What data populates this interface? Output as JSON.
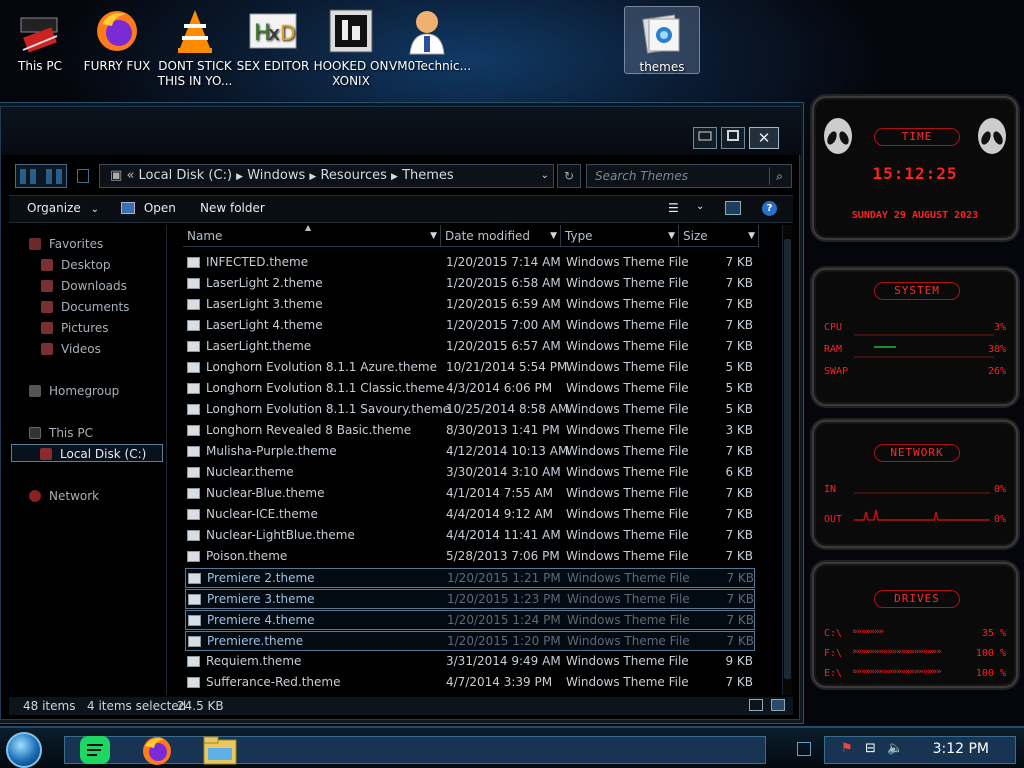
{
  "desktop_icons": [
    {
      "label": "This PC",
      "icon": "computer-icon"
    },
    {
      "label": "FURRY FUX",
      "icon": "firefox-icon"
    },
    {
      "label": "DONT STICK THIS IN YO...",
      "icon": "vlc-icon"
    },
    {
      "label": "SEX EDITOR",
      "icon": "hex-editor-icon"
    },
    {
      "label": "HOOKED ON XONIX",
      "icon": "game-icon"
    },
    {
      "label": "VM0Technic...",
      "icon": "doctor-icon"
    },
    {
      "label": "themes",
      "icon": "folder-icon"
    }
  ],
  "window": {
    "breadcrumb": [
      "Local Disk (C:)",
      "Windows",
      "Resources",
      "Themes"
    ],
    "search_placeholder": "Search Themes",
    "toolbar": {
      "organize": "Organize",
      "open": "Open",
      "new_folder": "New folder"
    },
    "nav": {
      "favorites": "Favorites",
      "desktop": "Desktop",
      "downloads": "Downloads",
      "documents": "Documents",
      "pictures": "Pictures",
      "videos": "Videos",
      "homegroup": "Homegroup",
      "this_pc": "This PC",
      "local_disk": "Local Disk (C:)",
      "network": "Network"
    },
    "columns": {
      "name": "Name",
      "date": "Date modified",
      "type": "Type",
      "size": "Size"
    },
    "files": [
      {
        "name": "INFECTED.theme",
        "date": "1/20/2015 7:14 AM",
        "type": "Windows Theme File",
        "size": "7 KB",
        "sel": false
      },
      {
        "name": "LaserLight 2.theme",
        "date": "1/20/2015 6:58 AM",
        "type": "Windows Theme File",
        "size": "7 KB",
        "sel": false
      },
      {
        "name": "LaserLight 3.theme",
        "date": "1/20/2015 6:59 AM",
        "type": "Windows Theme File",
        "size": "7 KB",
        "sel": false
      },
      {
        "name": "LaserLight 4.theme",
        "date": "1/20/2015 7:00 AM",
        "type": "Windows Theme File",
        "size": "7 KB",
        "sel": false
      },
      {
        "name": "LaserLight.theme",
        "date": "1/20/2015 6:57 AM",
        "type": "Windows Theme File",
        "size": "7 KB",
        "sel": false
      },
      {
        "name": "Longhorn Evolution 8.1.1 Azure.theme",
        "date": "10/21/2014 5:54 PM",
        "type": "Windows Theme File",
        "size": "5 KB",
        "sel": false
      },
      {
        "name": "Longhorn Evolution 8.1.1 Classic.theme",
        "date": "4/3/2014 6:06 PM",
        "type": "Windows Theme File",
        "size": "5 KB",
        "sel": false
      },
      {
        "name": "Longhorn Evolution 8.1.1 Savoury.theme",
        "date": "10/25/2014 8:58 AM",
        "type": "Windows Theme File",
        "size": "5 KB",
        "sel": false
      },
      {
        "name": "Longhorn Revealed 8 Basic.theme",
        "date": "8/30/2013 1:41 PM",
        "type": "Windows Theme File",
        "size": "3 KB",
        "sel": false
      },
      {
        "name": "Mulisha-Purple.theme",
        "date": "4/12/2014 10:13 AM",
        "type": "Windows Theme File",
        "size": "7 KB",
        "sel": false
      },
      {
        "name": "Nuclear.theme",
        "date": "3/30/2014 3:10 AM",
        "type": "Windows Theme File",
        "size": "6 KB",
        "sel": false
      },
      {
        "name": "Nuclear-Blue.theme",
        "date": "4/1/2014 7:55 AM",
        "type": "Windows Theme File",
        "size": "7 KB",
        "sel": false
      },
      {
        "name": "Nuclear-ICE.theme",
        "date": "4/4/2014 9:12 AM",
        "type": "Windows Theme File",
        "size": "7 KB",
        "sel": false
      },
      {
        "name": "Nuclear-LightBlue.theme",
        "date": "4/4/2014 11:41 AM",
        "type": "Windows Theme File",
        "size": "7 KB",
        "sel": false
      },
      {
        "name": "Poison.theme",
        "date": "5/28/2013 7:06 PM",
        "type": "Windows Theme File",
        "size": "7 KB",
        "sel": false
      },
      {
        "name": "Premiere 2.theme",
        "date": "1/20/2015 1:21 PM",
        "type": "Windows Theme File",
        "size": "7 KB",
        "sel": true
      },
      {
        "name": "Premiere 3.theme",
        "date": "1/20/2015 1:23 PM",
        "type": "Windows Theme File",
        "size": "7 KB",
        "sel": true
      },
      {
        "name": "Premiere 4.theme",
        "date": "1/20/2015 1:24 PM",
        "type": "Windows Theme File",
        "size": "7 KB",
        "sel": true
      },
      {
        "name": "Premiere.theme",
        "date": "1/20/2015 1:20 PM",
        "type": "Windows Theme File",
        "size": "7 KB",
        "sel": true
      },
      {
        "name": "Requiem.theme",
        "date": "3/31/2014 9:49 AM",
        "type": "Windows Theme File",
        "size": "9 KB",
        "sel": false
      },
      {
        "name": "Sufferance-Red.theme",
        "date": "4/7/2014 3:39 PM",
        "type": "Windows Theme File",
        "size": "7 KB",
        "sel": false
      }
    ],
    "status": {
      "items": "48 items",
      "selected": "4 items selected",
      "size": "24.5 KB"
    }
  },
  "gadgets": {
    "time": {
      "title": "TIME",
      "clock": "15:12:25",
      "date": "SUNDAY 29 AUGUST 2023"
    },
    "system": {
      "title": "SYSTEM",
      "rows": [
        {
          "label": "CPU",
          "value": "3%"
        },
        {
          "label": "RAM",
          "value": "38%"
        },
        {
          "label": "SWAP",
          "value": "26%"
        }
      ]
    },
    "network": {
      "title": "NETWORK",
      "rows": [
        {
          "label": "IN",
          "value": "0%"
        },
        {
          "label": "OUT",
          "value": "0%"
        }
      ]
    },
    "drives": {
      "title": "DRIVES",
      "rows": [
        {
          "label": "C:\\",
          "value": "35 %"
        },
        {
          "label": "F:\\",
          "value": "100 %"
        },
        {
          "label": "E:\\",
          "value": "100 %"
        }
      ]
    }
  },
  "taskbar": {
    "clock": "3:12 PM"
  },
  "colors": {
    "gadget_red": "#ff2020",
    "selection": "#5c7891",
    "taskbar": "#173552"
  }
}
